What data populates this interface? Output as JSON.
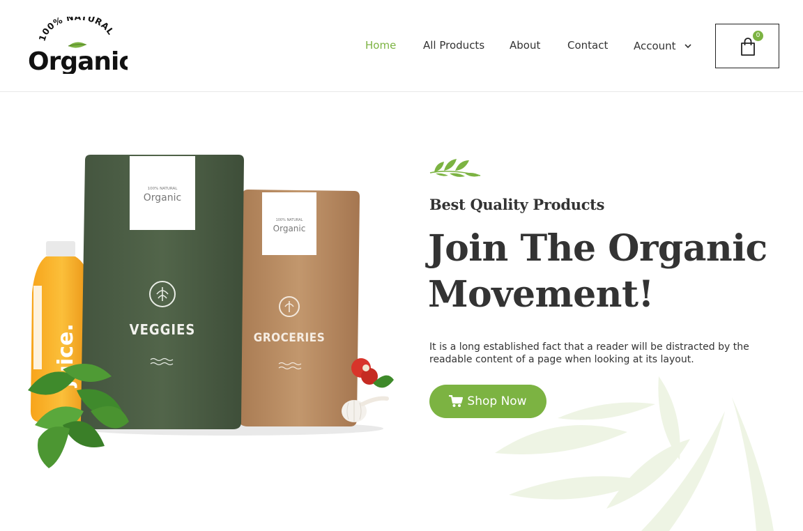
{
  "brand": {
    "logo_top_text": "100% NATURAL",
    "logo_main_text": "Organic"
  },
  "nav": {
    "items": [
      {
        "label": "Home",
        "active": true
      },
      {
        "label": "All Products",
        "active": false
      },
      {
        "label": "About",
        "active": false
      },
      {
        "label": "Contact",
        "active": false
      },
      {
        "label": "Account",
        "active": false,
        "has_dropdown": true
      }
    ],
    "cart_count": "0"
  },
  "hero": {
    "subtitle": "Best Quality Products",
    "title": "Join The Organic Movement!",
    "description": "It is a long established fact that a reader will be distracted by the readable content of a page when looking at its layout.",
    "cta_label": "Shop Now",
    "cta_icon": "cart-icon",
    "product_image": {
      "bottle_label": "juice.",
      "bag_1_brand": "Organic",
      "bag_1_brand_top": "100% NATURAL",
      "bag_1_label": "VEGGIES",
      "bag_2_brand": "Organic",
      "bag_2_brand_top": "100% NATURAL",
      "bag_2_label": "GROCERIES"
    }
  },
  "colors": {
    "accent": "#7cb342",
    "text": "#333333",
    "bag_green": "#4a5c43",
    "bag_kraft": "#b58a63"
  }
}
